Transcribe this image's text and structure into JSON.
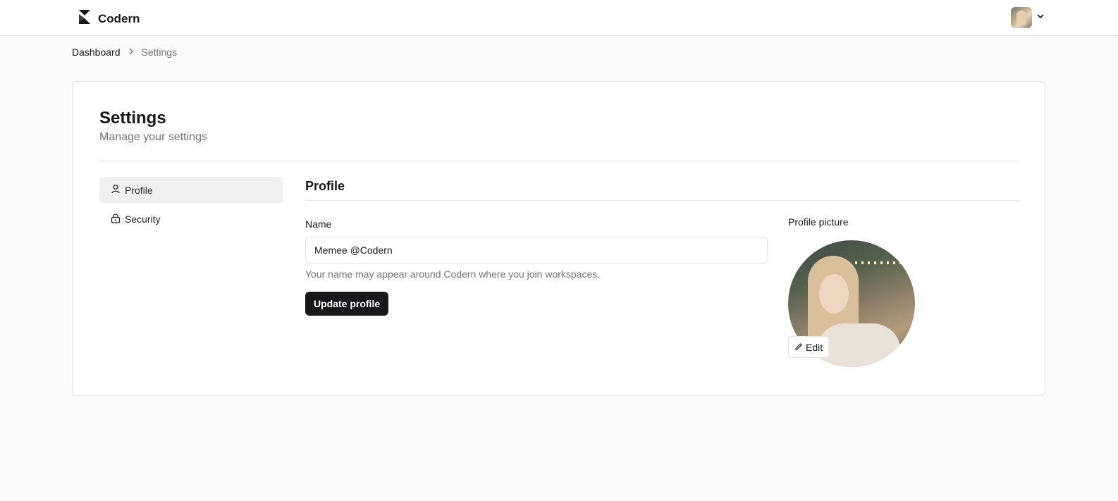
{
  "header": {
    "brand_name": "Codern",
    "logo_icon": "codern-logo-icon",
    "user_menu_icon": "chevron-down-icon"
  },
  "breadcrumb": {
    "items": [
      "Dashboard",
      "Settings"
    ],
    "separator_icon": "chevron-right-icon"
  },
  "settings": {
    "title": "Settings",
    "subtitle": "Manage your settings"
  },
  "sidebar": {
    "items": [
      {
        "label": "Profile",
        "icon": "user-icon",
        "active": true
      },
      {
        "label": "Security",
        "icon": "lock-icon",
        "active": false
      }
    ]
  },
  "profile": {
    "section_title": "Profile",
    "name_label": "Name",
    "name_value": "Memee @Codern",
    "name_help": "Your name may appear around Codern where you join workspaces.",
    "update_button": "Update profile",
    "picture_label": "Profile picture",
    "edit_button": "Edit",
    "edit_icon": "pencil-icon"
  },
  "colors": {
    "primary": "#18181b",
    "muted_text": "#71717a",
    "border": "#e4e4e7",
    "background": "#fafafa"
  }
}
